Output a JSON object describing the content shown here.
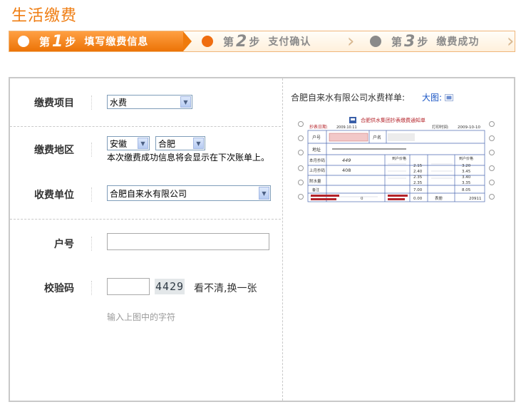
{
  "page": {
    "title": "生活缴费"
  },
  "steps": [
    {
      "pre": "第",
      "num": "1",
      "post": "步",
      "text": "填写缴费信息"
    },
    {
      "pre": "第",
      "num": "2",
      "post": "步",
      "text": "支付确认"
    },
    {
      "pre": "第",
      "num": "3",
      "post": "步",
      "text": "缴费成功"
    }
  ],
  "form": {
    "item_label": "缴费项目",
    "item_value": "水费",
    "region_label": "缴费地区",
    "province_value": "安徽",
    "city_value": "合肥",
    "region_note": "本次缴费成功信息将会显示在下次账单上。",
    "unit_label": "收费单位",
    "unit_value": "合肥自来水有限公司",
    "account_label": "户号",
    "account_value": "",
    "code_label": "校验码",
    "code_value": "",
    "captcha_text": "4429",
    "refresh_label": "看不清,换一张",
    "code_hint": "输入上图中的字符"
  },
  "sample": {
    "caption": "合肥自来水有限公司水费样单:",
    "big_label": "大图:"
  },
  "bill": {
    "title": "合肥供水集团抄表缴费通知单",
    "read_date_label": "抄表日期:",
    "read_date_value": "2009.10.11",
    "print_time_label": "打印时间:",
    "print_time_value": "2009-10-10",
    "account_label": "户号",
    "name_label": "户名",
    "address_label": "地址",
    "this_reading_label": "本月抄码",
    "last_reading_label": "上月抄码",
    "this_reading_value": "449",
    "last_reading_value": "408",
    "water_volume_label": "附水量",
    "note_label": "备注",
    "price_header": "到户价格",
    "prices_left": [
      "2.15",
      "2.40",
      "2.35",
      "2.35",
      "7.00"
    ],
    "prices_right": [
      "3.20",
      "3.45",
      "3.40",
      "3.35",
      "8.05"
    ],
    "total_label": "表册",
    "total_value": "20911",
    "amount_value": "0.00",
    "usage_value": "0"
  }
}
